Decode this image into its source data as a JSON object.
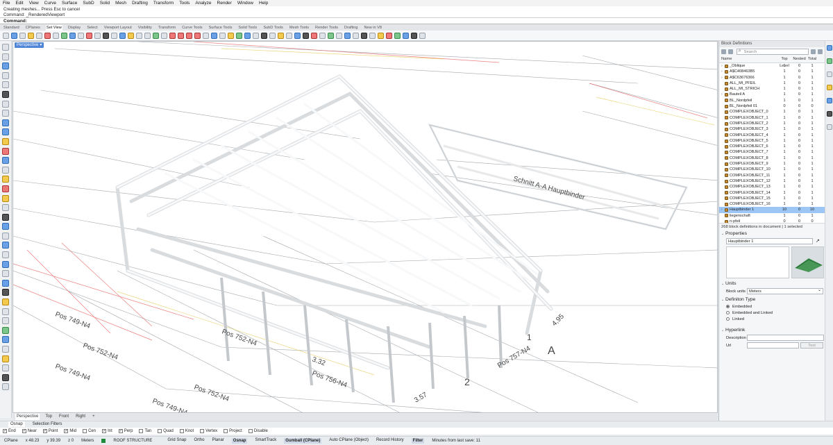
{
  "menu": [
    "File",
    "Edit",
    "View",
    "Curve",
    "Surface",
    "SubD",
    "Solid",
    "Mesh",
    "Drafting",
    "Transform",
    "Tools",
    "Analyze",
    "Render",
    "Window",
    "Help"
  ],
  "history": [
    "Creating meshes... Press Esc to cancel",
    "Command: _RenderedViewport"
  ],
  "command_prompt": "Command:",
  "toolbar_tabs": [
    "Standard",
    "CPlanes",
    "Set View",
    "Display",
    "Select",
    "Viewport Layout",
    "Visibility",
    "Transform",
    "Curve Tools",
    "Surface Tools",
    "Solid Tools",
    "SubD Tools",
    "Mesh Tools",
    "Render Tools",
    "Drafting",
    "New in V8"
  ],
  "active_toolbar_tab": "Set View",
  "viewport": {
    "title": "Perspective",
    "tabs": [
      "Perspective",
      "Top",
      "Front",
      "Right"
    ],
    "annotations": [
      "Pos 749-N4",
      "Pos 752-N4",
      "Pos 749-N4",
      "Pos 752-N4",
      "Pos 749-N4",
      "Pos 752-N4",
      "Pos 756-N4",
      "Pos 757-N4",
      "3.57",
      "3.32",
      "4,95",
      "Schnitt A-A Hauptbinder",
      "A",
      "1",
      "2"
    ]
  },
  "block_definitions": {
    "title": "Block Definitions",
    "search_placeholder": "Search",
    "columns": [
      "Name",
      "Top Level",
      "Nested",
      "Total"
    ],
    "rows": [
      {
        "name": "_Oblique",
        "top": "1",
        "nested": "0",
        "total": "1",
        "exp": "›"
      },
      {
        "name": "A$C408463B5",
        "top": "1",
        "nested": "0",
        "total": "1",
        "exp": "›"
      },
      {
        "name": "A$C63676366",
        "top": "1",
        "nested": "0",
        "total": "1",
        "exp": "›"
      },
      {
        "name": "ALL_MI_PFEIL",
        "top": "1",
        "nested": "0",
        "total": "1",
        "exp": ""
      },
      {
        "name": "ALL_MI_STRICH",
        "top": "1",
        "nested": "0",
        "total": "1",
        "exp": ""
      },
      {
        "name": "Bauteil A",
        "top": "1",
        "nested": "0",
        "total": "1",
        "exp": "›"
      },
      {
        "name": "BL_Nordpfeil",
        "top": "1",
        "nested": "0",
        "total": "1",
        "exp": ""
      },
      {
        "name": "BL_Nordpfeil 01",
        "top": "0",
        "nested": "0",
        "total": "0",
        "exp": ""
      },
      {
        "name": "COMPLEXOBJECT_0",
        "top": "1",
        "nested": "0",
        "total": "1",
        "exp": ""
      },
      {
        "name": "COMPLEXOBJECT_1",
        "top": "1",
        "nested": "0",
        "total": "1",
        "exp": ""
      },
      {
        "name": "COMPLEXOBJECT_2",
        "top": "1",
        "nested": "0",
        "total": "1",
        "exp": ""
      },
      {
        "name": "COMPLEXOBJECT_3",
        "top": "1",
        "nested": "0",
        "total": "1",
        "exp": ""
      },
      {
        "name": "COMPLEXOBJECT_4",
        "top": "1",
        "nested": "0",
        "total": "1",
        "exp": ""
      },
      {
        "name": "COMPLEXOBJECT_5",
        "top": "1",
        "nested": "0",
        "total": "1",
        "exp": ""
      },
      {
        "name": "COMPLEXOBJECT_6",
        "top": "1",
        "nested": "0",
        "total": "1",
        "exp": ""
      },
      {
        "name": "COMPLEXOBJECT_7",
        "top": "1",
        "nested": "0",
        "total": "1",
        "exp": ""
      },
      {
        "name": "COMPLEXOBJECT_8",
        "top": "1",
        "nested": "0",
        "total": "1",
        "exp": ""
      },
      {
        "name": "COMPLEXOBJECT_9",
        "top": "1",
        "nested": "0",
        "total": "1",
        "exp": ""
      },
      {
        "name": "COMPLEXOBJECT_10",
        "top": "1",
        "nested": "0",
        "total": "1",
        "exp": ""
      },
      {
        "name": "COMPLEXOBJECT_11",
        "top": "1",
        "nested": "0",
        "total": "1",
        "exp": ""
      },
      {
        "name": "COMPLEXOBJECT_12",
        "top": "1",
        "nested": "0",
        "total": "1",
        "exp": ""
      },
      {
        "name": "COMPLEXOBJECT_13",
        "top": "1",
        "nested": "0",
        "total": "1",
        "exp": ""
      },
      {
        "name": "COMPLEXOBJECT_14",
        "top": "1",
        "nested": "0",
        "total": "1",
        "exp": ""
      },
      {
        "name": "COMPLEXOBJECT_15",
        "top": "1",
        "nested": "0",
        "total": "1",
        "exp": ""
      },
      {
        "name": "COMPLEXOBJECT_16",
        "top": "1",
        "nested": "0",
        "total": "1",
        "exp": ""
      },
      {
        "name": "Hauptbinder 1",
        "top": "10",
        "nested": "0",
        "total": "10",
        "exp": "›",
        "selected": true
      },
      {
        "name": "liegenschaft",
        "top": "1",
        "nested": "0",
        "total": "1",
        "exp": ""
      },
      {
        "name": "n-pfeil",
        "top": "0",
        "nested": "0",
        "total": "0",
        "exp": ""
      }
    ],
    "count_text": "268 block definitions in document | 1 selected"
  },
  "properties": {
    "title": "Properties",
    "name_value": "Hauptbinder 1"
  },
  "units": {
    "title": "Units",
    "label": "Block units",
    "value": "Meters"
  },
  "definition_type": {
    "title": "Definiton Type",
    "options": [
      "Embedded",
      "Embedded and Linked",
      "Linked"
    ],
    "selected": "Embedded"
  },
  "hyperlink": {
    "title": "Hyperlink",
    "description_label": "Description",
    "url_label": "Url",
    "test_label": "Test"
  },
  "osnap_tabs": [
    "Osnap",
    "Selection Filters"
  ],
  "osnaps": [
    {
      "label": "End",
      "checked": true
    },
    {
      "label": "Near",
      "checked": true
    },
    {
      "label": "Point",
      "checked": true
    },
    {
      "label": "Mid",
      "checked": true
    },
    {
      "label": "Cen",
      "checked": false
    },
    {
      "label": "Int",
      "checked": true
    },
    {
      "label": "Perp",
      "checked": true
    },
    {
      "label": "Tan",
      "checked": false
    },
    {
      "label": "Quad",
      "checked": false
    },
    {
      "label": "Knot",
      "checked": false
    },
    {
      "label": "Vertex",
      "checked": false
    },
    {
      "label": "Project",
      "checked": false
    },
    {
      "label": "Disable",
      "checked": false
    }
  ],
  "status": {
    "cplane": "CPlane",
    "x": "x 48.23",
    "y": "y 39.39",
    "z": "z 0",
    "units": "Meters",
    "layer": "ROOF STRUCTURE",
    "layer_color": "#1f8a3c",
    "items": [
      "Grid Snap",
      "Ortho",
      "Planar",
      "Osnap",
      "SmartTrack",
      "Gumball (CPlane)",
      "Auto CPlane (Object)",
      "Record History",
      "Filter"
    ],
    "highlighted": [
      "Osnap",
      "Gumball (CPlane)",
      "Filter"
    ],
    "minutes": "Minutes from last save: 11"
  }
}
